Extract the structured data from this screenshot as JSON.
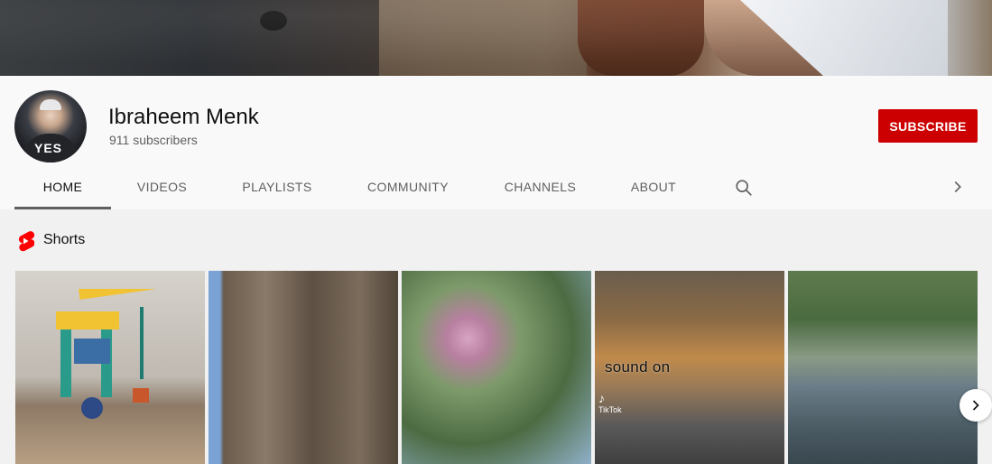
{
  "channel": {
    "name": "Ibraheem Menk",
    "subscribers": "911 subscribers",
    "subscribe_label": "SUBSCRIBE",
    "avatar_shirt_text": "YES"
  },
  "tabs": [
    {
      "label": "HOME",
      "active": true
    },
    {
      "label": "VIDEOS",
      "active": false
    },
    {
      "label": "PLAYLISTS",
      "active": false
    },
    {
      "label": "COMMUNITY",
      "active": false
    },
    {
      "label": "CHANNELS",
      "active": false
    },
    {
      "label": "ABOUT",
      "active": false
    }
  ],
  "shorts": {
    "title": "Shorts",
    "items": [
      {
        "overlay": ""
      },
      {
        "overlay": ""
      },
      {
        "overlay": ""
      },
      {
        "overlay": "sound on",
        "watermark": "TikTok"
      },
      {
        "overlay": ""
      }
    ]
  },
  "icons": {
    "search": "search-icon",
    "tabs_next": "chevron-right-icon",
    "shorts_logo": "shorts-icon",
    "carousel_next": "chevron-right-icon"
  },
  "colors": {
    "subscribe_bg": "#cc0000",
    "shorts_logo": "#ff0000"
  }
}
